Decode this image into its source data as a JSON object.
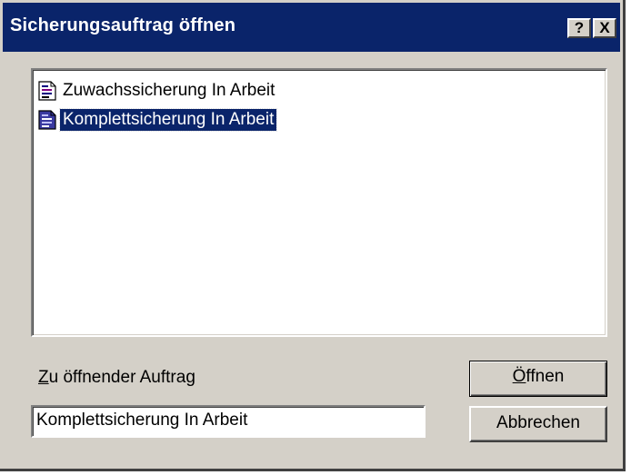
{
  "window": {
    "title": "Sicherungsauftrag öffnen",
    "help_label": "?",
    "close_label": "X"
  },
  "list": {
    "items": [
      {
        "label": "Zuwachssicherung In Arbeit",
        "icon": "backup-job-document-icon",
        "selected": false
      },
      {
        "label": "Komplettsicherung In Arbeit",
        "icon": "backup-job-document-icon",
        "selected": true
      }
    ]
  },
  "field": {
    "label_prefix": "Z",
    "label_rest": "u öffnender Auftrag",
    "value": "Komplettsicherung In Arbeit"
  },
  "buttons": {
    "open_prefix": "Ö",
    "open_rest": "ffnen",
    "cancel": "Abbrechen"
  },
  "colors": {
    "titlebar": "#0a246a",
    "face": "#d4d0c8",
    "selection": "#0a246a"
  }
}
